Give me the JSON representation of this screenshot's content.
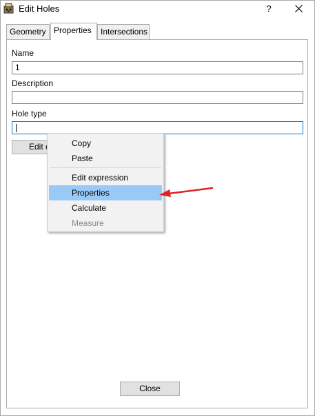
{
  "window": {
    "title": "Edit Holes",
    "help_label": "?",
    "app_icon": "app-icon",
    "close_icon": "close-icon"
  },
  "tabs": [
    {
      "label": "Geometry",
      "active": false
    },
    {
      "label": "Properties",
      "active": true
    },
    {
      "label": "Intersections",
      "active": false
    }
  ],
  "form": {
    "name_label": "Name",
    "name_value": "1",
    "description_label": "Description",
    "description_value": "",
    "hole_type_label": "Hole type",
    "hole_type_value": "",
    "edit_button_label": "Edit e"
  },
  "context_menu": {
    "items": [
      {
        "label": "Copy",
        "enabled": true
      },
      {
        "label": "Paste",
        "enabled": true
      },
      {
        "label": "Edit expression",
        "enabled": true
      },
      {
        "label": "Properties",
        "enabled": true,
        "highlighted": true
      },
      {
        "label": "Calculate",
        "enabled": true
      },
      {
        "label": "Measure",
        "enabled": false
      }
    ],
    "highlight_color": "#99c9f7"
  },
  "annotation": {
    "arrow_color": "#e02020",
    "arrow_target": "Properties"
  },
  "footer": {
    "close_label": "Close"
  }
}
